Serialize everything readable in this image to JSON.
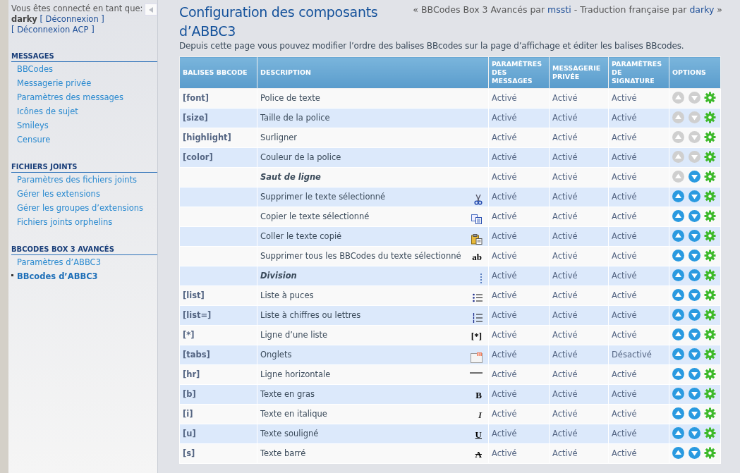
{
  "sidebar": {
    "user_prefix": "Vous êtes connecté en tant que:",
    "username": "darky",
    "logout": "[ Déconnexion ]",
    "logout_acp": "[ Déconnexion ACP ]",
    "sections": [
      {
        "title": "MESSAGES",
        "items": [
          {
            "label": "BBCodes",
            "selected": false
          },
          {
            "label": "Messagerie privée",
            "selected": false
          },
          {
            "label": "Paramètres des messages",
            "selected": false
          },
          {
            "label": "Icônes de sujet",
            "selected": false
          },
          {
            "label": "Smileys",
            "selected": false
          },
          {
            "label": "Censure",
            "selected": false
          }
        ]
      },
      {
        "title": "FICHIERS JOINTS",
        "items": [
          {
            "label": "Paramètres des fichiers joints",
            "selected": false
          },
          {
            "label": "Gérer les extensions",
            "selected": false
          },
          {
            "label": "Gérer les groupes d’extensions",
            "selected": false
          },
          {
            "label": "Fichiers joints orphelins",
            "selected": false
          }
        ]
      },
      {
        "title": "BBCODES BOX 3 AVANCÉS",
        "items": [
          {
            "label": "Paramètres d’ABBC3",
            "selected": false
          },
          {
            "label": "BBcodes d’ABBC3",
            "selected": true
          }
        ]
      }
    ]
  },
  "header": {
    "title": "Configuration des composants d’ABBC3",
    "credit_prefix": "« BBCodes Box 3 Avancés par",
    "credit_author": "mssti",
    "credit_middle": "- Traduction française par",
    "credit_translator": "darky",
    "credit_suffix": "»",
    "description": "Depuis cette page vous pouvez modifier l’ordre des balises BBcodes sur la page d’affichage et éditer les balises BBcodes."
  },
  "table": {
    "columns": [
      "BALISES BBCODE",
      "DESCRIPTION",
      "PARAMÈTRES DES MESSAGES",
      "MESSAGERIE PRIVÉE",
      "PARAMÈTRES DE SIGNATURE",
      "OPTIONS"
    ],
    "rows": [
      {
        "kind": "bbcode",
        "tag": "[font]",
        "description": "Police de texte",
        "posts": "Activé",
        "pm": "Activé",
        "signature": "Activé",
        "up_enabled": false,
        "down_enabled": false
      },
      {
        "kind": "bbcode",
        "tag": "[size]",
        "description": "Taille de la police",
        "posts": "Activé",
        "pm": "Activé",
        "signature": "Activé",
        "up_enabled": false,
        "down_enabled": false
      },
      {
        "kind": "bbcode",
        "tag": "[highlight]",
        "description": "Surligner",
        "posts": "Activé",
        "pm": "Activé",
        "signature": "Activé",
        "up_enabled": false,
        "down_enabled": false
      },
      {
        "kind": "bbcode",
        "tag": "[color]",
        "description": "Couleur de la police",
        "posts": "Activé",
        "pm": "Activé",
        "signature": "Activé",
        "up_enabled": false,
        "down_enabled": false
      },
      {
        "kind": "divider",
        "description": "Saut de ligne",
        "posts": "Activé",
        "pm": "Activé",
        "signature": "Activé",
        "up_enabled": false,
        "down_enabled": true
      },
      {
        "kind": "bbcode",
        "description": "Supprimer le texte sélectionné",
        "posts": "Activé",
        "pm": "Activé",
        "signature": "Activé",
        "up_enabled": true,
        "down_enabled": true
      },
      {
        "kind": "bbcode",
        "description": "Copier le texte sélectionné",
        "posts": "Activé",
        "pm": "Activé",
        "signature": "Activé",
        "up_enabled": true,
        "down_enabled": true
      },
      {
        "kind": "bbcode",
        "description": "Coller le texte copié",
        "posts": "Activé",
        "pm": "Activé",
        "signature": "Activé",
        "up_enabled": true,
        "down_enabled": true
      },
      {
        "kind": "bbcode",
        "description": "Supprimer tous les BBCodes du texte sélectionné",
        "glyph": "ab",
        "posts": "Activé",
        "pm": "Activé",
        "signature": "Activé",
        "up_enabled": true,
        "down_enabled": true
      },
      {
        "kind": "divider",
        "description": "Division",
        "posts": "Activé",
        "pm": "Activé",
        "signature": "Activé",
        "up_enabled": true,
        "down_enabled": true
      },
      {
        "kind": "bbcode",
        "tag": "[list]",
        "description": "Liste à puces",
        "posts": "Activé",
        "pm": "Activé",
        "signature": "Activé",
        "up_enabled": true,
        "down_enabled": true
      },
      {
        "kind": "bbcode",
        "tag": "[list=]",
        "description": "Liste à chiffres ou lettres",
        "posts": "Activé",
        "pm": "Activé",
        "signature": "Activé",
        "up_enabled": true,
        "down_enabled": true
      },
      {
        "kind": "bbcode",
        "tag": "[*]",
        "description": "Ligne d’une liste",
        "glyph": "[*]",
        "posts": "Activé",
        "pm": "Activé",
        "signature": "Activé",
        "up_enabled": true,
        "down_enabled": true
      },
      {
        "kind": "bbcode",
        "tag": "[tabs]",
        "description": "Onglets",
        "posts": "Activé",
        "pm": "Activé",
        "signature": "Désactivé",
        "up_enabled": true,
        "down_enabled": true
      },
      {
        "kind": "bbcode",
        "tag": "[hr]",
        "description": "Ligne horizontale",
        "posts": "Activé",
        "pm": "Activé",
        "signature": "Activé",
        "up_enabled": true,
        "down_enabled": true
      },
      {
        "kind": "bbcode",
        "tag": "[b]",
        "description": "Texte en gras",
        "glyph": "B",
        "posts": "Activé",
        "pm": "Activé",
        "signature": "Activé",
        "up_enabled": true,
        "down_enabled": true
      },
      {
        "kind": "bbcode",
        "tag": "[i]",
        "description": "Texte en italique",
        "glyph": "I",
        "posts": "Activé",
        "pm": "Activé",
        "signature": "Activé",
        "up_enabled": true,
        "down_enabled": true
      },
      {
        "kind": "bbcode",
        "tag": "[u]",
        "description": "Texte souligné",
        "glyph": "U",
        "posts": "Activé",
        "pm": "Activé",
        "signature": "Activé",
        "up_enabled": true,
        "down_enabled": true
      },
      {
        "kind": "bbcode",
        "tag": "[s]",
        "description": "Texte barré",
        "glyph": "A",
        "posts": "Activé",
        "pm": "Activé",
        "signature": "Activé",
        "up_enabled": true,
        "down_enabled": true
      }
    ]
  }
}
